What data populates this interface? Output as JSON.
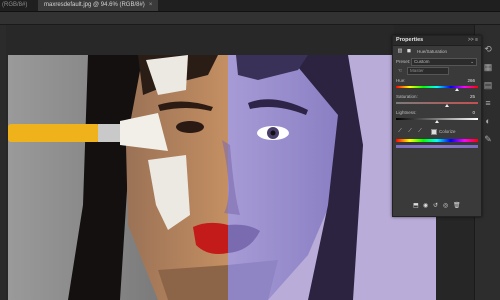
{
  "tabs": [
    {
      "label": "(RGB/8#)",
      "active": false
    },
    {
      "label": "maxresdefault.jpg @ 94.6% (RGB/8#)",
      "active": true,
      "close": "×"
    }
  ],
  "panel": {
    "title": "Properties",
    "controls": ">> ≡",
    "adjustment_name": "Hue/Saturation",
    "preset_label": "Preset:",
    "preset_value": "Custom",
    "channel_value": "Master",
    "hue_label": "Hue:",
    "hue_value": "266",
    "hue_fraction": 0.74,
    "saturation_label": "Saturation:",
    "saturation_value": "25",
    "saturation_fraction": 0.625,
    "lightness_label": "Lightness:",
    "lightness_value": "0",
    "lightness_fraction": 0.5,
    "colorize_label": "Colorize",
    "colorize_checked": true
  },
  "colors": {
    "accent": "#8a79c8",
    "lips": "#c31a1a",
    "brush_handle": "#f0b21a"
  }
}
